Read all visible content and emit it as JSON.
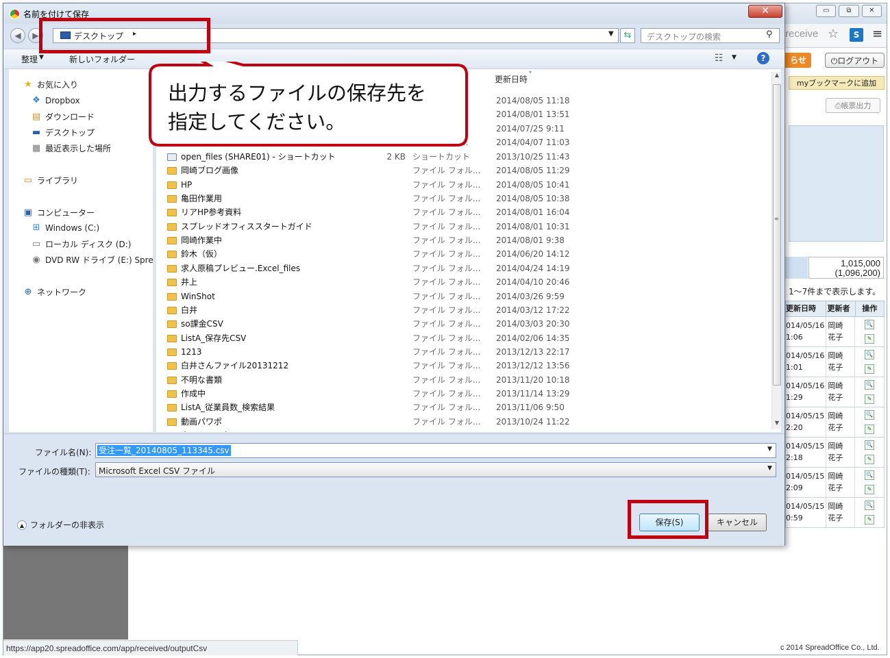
{
  "background_page": {
    "window_controls": [
      "▭",
      "⧉",
      "✕"
    ],
    "omnibox_tail": "receive",
    "orange_tab": "らせ",
    "logout": "ログアウト",
    "bookmark": "myブックマークに追加",
    "report_button": "帳票出力",
    "totals": [
      "1,015,000",
      "(1,096,200)"
    ],
    "shown_text": "1～7件まで表示します。",
    "table": {
      "headers": [
        "更新日時",
        "更新者",
        "操作"
      ],
      "rows": [
        {
          "date": "014/05/16",
          "time": "1:06",
          "user1": "岡崎",
          "user2": "花子"
        },
        {
          "date": "014/05/16",
          "time": "1:01",
          "user1": "岡崎",
          "user2": "花子"
        },
        {
          "date": "014/05/16",
          "time": "1:29",
          "user1": "岡崎",
          "user2": "花子"
        },
        {
          "date": "014/05/15",
          "time": "2:20",
          "user1": "岡崎",
          "user2": "花子"
        },
        {
          "date": "014/05/15",
          "time": "2:18",
          "user1": "岡崎",
          "user2": "花子"
        },
        {
          "date": "014/05/15",
          "time": "2:09",
          "user1": "岡崎",
          "user2": "花子"
        },
        {
          "date": "014/05/15",
          "time": "0:59",
          "user1": "岡崎",
          "user2": "花子"
        }
      ]
    },
    "status_url": "https://app20.spreadoffice.com/app/received/outputCsv",
    "copyright": "c 2014 SpreadOffice Co., Ltd."
  },
  "dialog": {
    "title": "名前を付けて保存",
    "close": "✕",
    "address": "デスクトップ",
    "search_placeholder": "デスクトップの検索",
    "organize": "整理",
    "new_folder": "新しいフォルダー",
    "help": "?",
    "nav": {
      "favorites": "お気に入り",
      "fav_items": [
        "Dropbox",
        "ダウンロード",
        "デスクトップ",
        "最近表示した場所"
      ],
      "libraries": "ライブラリ",
      "computer": "コンピューター",
      "computer_items": [
        "Windows (C:)",
        "ローカル ディスク (D:)",
        "DVD RW ドライブ (E:) Spre"
      ],
      "network": "ネットワーク"
    },
    "list_header_date": "更新日時",
    "partial_rows": [
      {
        "trail": "...",
        "date": "2014/08/05 11:18"
      },
      {
        "trail": "...",
        "date": "2014/08/01 13:51"
      },
      {
        "trail": "",
        "date": "2014/07/25 9:11"
      },
      {
        "trail": "...",
        "date": "2014/04/07 11:03"
      }
    ],
    "files": [
      {
        "name": "open_files (SHARE01) - ショートカット",
        "size": "2 KB",
        "type": "ショートカット",
        "date": "2013/10/25 11:43",
        "shortcut": true
      },
      {
        "name": "岡崎ブログ画像",
        "size": "",
        "type": "ファイル フォル...",
        "date": "2014/08/05 11:29"
      },
      {
        "name": "HP",
        "size": "",
        "type": "ファイル フォル...",
        "date": "2014/08/05 10:41"
      },
      {
        "name": "亀田作業用",
        "size": "",
        "type": "ファイル フォル...",
        "date": "2014/08/05 10:38"
      },
      {
        "name": "リアHP参考資料",
        "size": "",
        "type": "ファイル フォル...",
        "date": "2014/08/01 16:04"
      },
      {
        "name": "スプレッドオフィススタートガイド",
        "size": "",
        "type": "ファイル フォル...",
        "date": "2014/08/01 10:31"
      },
      {
        "name": "岡崎作業中",
        "size": "",
        "type": "ファイル フォル...",
        "date": "2014/08/01 9:38"
      },
      {
        "name": "鈴木（仮）",
        "size": "",
        "type": "ファイル フォル...",
        "date": "2014/06/20 14:12"
      },
      {
        "name": "求人原稿プレビュー.Excel_files",
        "size": "",
        "type": "ファイル フォル...",
        "date": "2014/04/24 14:19"
      },
      {
        "name": "井上",
        "size": "",
        "type": "ファイル フォル...",
        "date": "2014/04/10 20:46"
      },
      {
        "name": "WinShot",
        "size": "",
        "type": "ファイル フォル...",
        "date": "2014/03/26 9:59"
      },
      {
        "name": "白井",
        "size": "",
        "type": "ファイル フォル...",
        "date": "2014/03/12 17:22"
      },
      {
        "name": "so課金CSV",
        "size": "",
        "type": "ファイル フォル...",
        "date": "2014/03/03 20:30"
      },
      {
        "name": "ListA_保存先CSV",
        "size": "",
        "type": "ファイル フォル...",
        "date": "2014/02/06 14:35"
      },
      {
        "name": "1213",
        "size": "",
        "type": "ファイル フォル...",
        "date": "2013/12/13 22:17"
      },
      {
        "name": "白井さんファイル20131212",
        "size": "",
        "type": "ファイル フォル...",
        "date": "2013/12/12 13:56"
      },
      {
        "name": "不明な書類",
        "size": "",
        "type": "ファイル フォル...",
        "date": "2013/11/20 10:18"
      },
      {
        "name": "作成中",
        "size": "",
        "type": "ファイル フォル...",
        "date": "2013/11/14 13:29"
      },
      {
        "name": "ListA_従業員数_検索結果",
        "size": "",
        "type": "ファイル フォル...",
        "date": "2013/11/06 9:50"
      },
      {
        "name": "動画パワポ",
        "size": "",
        "type": "ファイル フォル...",
        "date": "2013/10/24 11:22"
      },
      {
        "name": "ネットワーク",
        "size": "",
        "type": "",
        "date": ""
      }
    ],
    "filename_label": "ファイル名(N):",
    "filename_value": "受注一覧_20140805_113345.csv",
    "filetype_label": "ファイルの種類(T):",
    "filetype_value": "Microsoft Excel CSV ファイル",
    "hide_folders": "フォルダーの非表示",
    "save_button": "保存(S)",
    "cancel_button": "キャンセル"
  },
  "annotation": {
    "callout_line1": "出力するファイルの保存先を",
    "callout_line2": "指定してください。",
    "highlight_color": "#c00010"
  }
}
